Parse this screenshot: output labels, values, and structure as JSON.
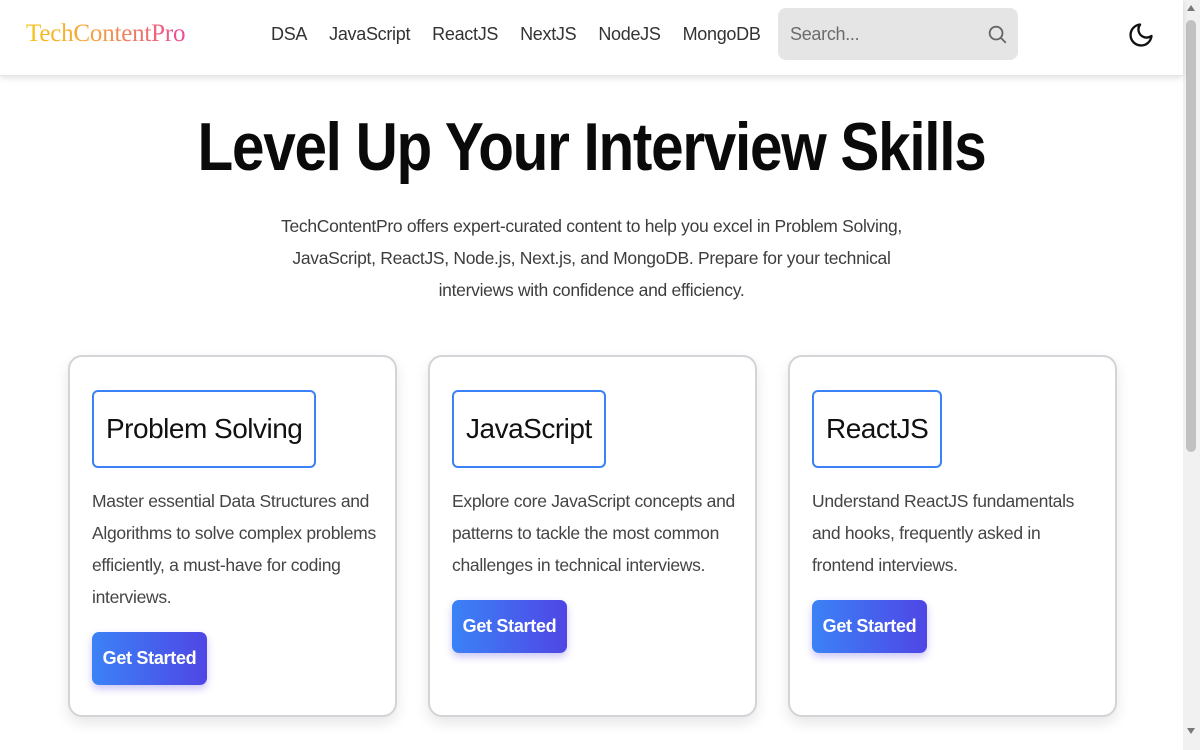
{
  "header": {
    "brand": "TechContentPro",
    "nav": [
      {
        "label": "DSA"
      },
      {
        "label": "JavaScript"
      },
      {
        "label": "ReactJS"
      },
      {
        "label": "NextJS"
      },
      {
        "label": "NodeJS"
      },
      {
        "label": "MongoDB"
      }
    ],
    "search": {
      "placeholder": "Search...",
      "value": "",
      "icon": "search-icon"
    },
    "theme_toggle_icon": "moon-icon"
  },
  "hero": {
    "title": "Level Up Your Interview Skills",
    "description": "TechContentPro offers expert-curated content to help you excel in Problem Solving, JavaScript, ReactJS, Node.js, Next.js, and MongoDB. Prepare for your technical interviews with confidence and efficiency."
  },
  "cards": [
    {
      "title": "Problem Solving",
      "description": "Master essential Data Structures and Algorithms to solve complex problems efficiently, a must-have for coding interviews.",
      "cta": "Get Started"
    },
    {
      "title": "JavaScript",
      "description": "Explore core JavaScript concepts and patterns to tackle the most common challenges in technical interviews.",
      "cta": "Get Started"
    },
    {
      "title": "ReactJS",
      "description": "Understand ReactJS fundamentals and hooks, frequently asked in frontend interviews.",
      "cta": "Get Started"
    }
  ],
  "colors": {
    "accent_border": "#3b82f6",
    "button_gradient_start": "#3b82f6",
    "button_gradient_end": "#4f46e5",
    "search_bg": "#e5e5e5"
  }
}
